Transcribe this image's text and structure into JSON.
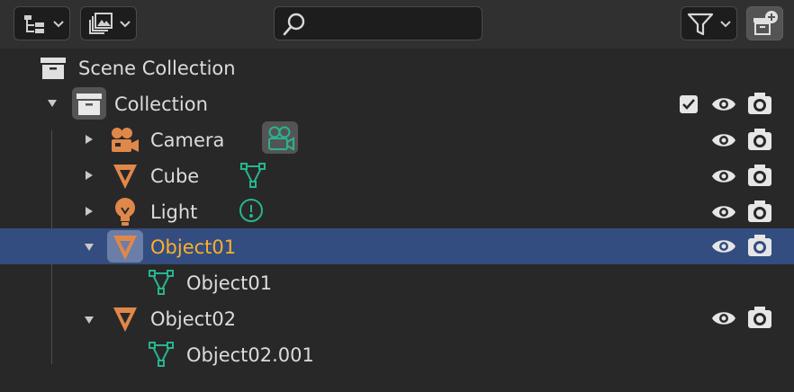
{
  "outliner": {
    "scene_collection": "Scene Collection",
    "collection": "Collection",
    "items": [
      {
        "label": "Camera"
      },
      {
        "label": "Cube"
      },
      {
        "label": "Light"
      },
      {
        "label": "Object01",
        "child": "Object01"
      },
      {
        "label": "Object02",
        "child": "Object02.001"
      }
    ]
  },
  "colors": {
    "object_orange": "#e0884a",
    "data_green": "#27b48f",
    "selected_row": "#334d80",
    "active_text": "#ffaf29"
  },
  "icons": {
    "display_mode": "outliner-tree-icon",
    "filter_library": "library-icon",
    "search": "search-icon",
    "filter": "filter-icon",
    "new_collection": "new-collection-icon"
  }
}
